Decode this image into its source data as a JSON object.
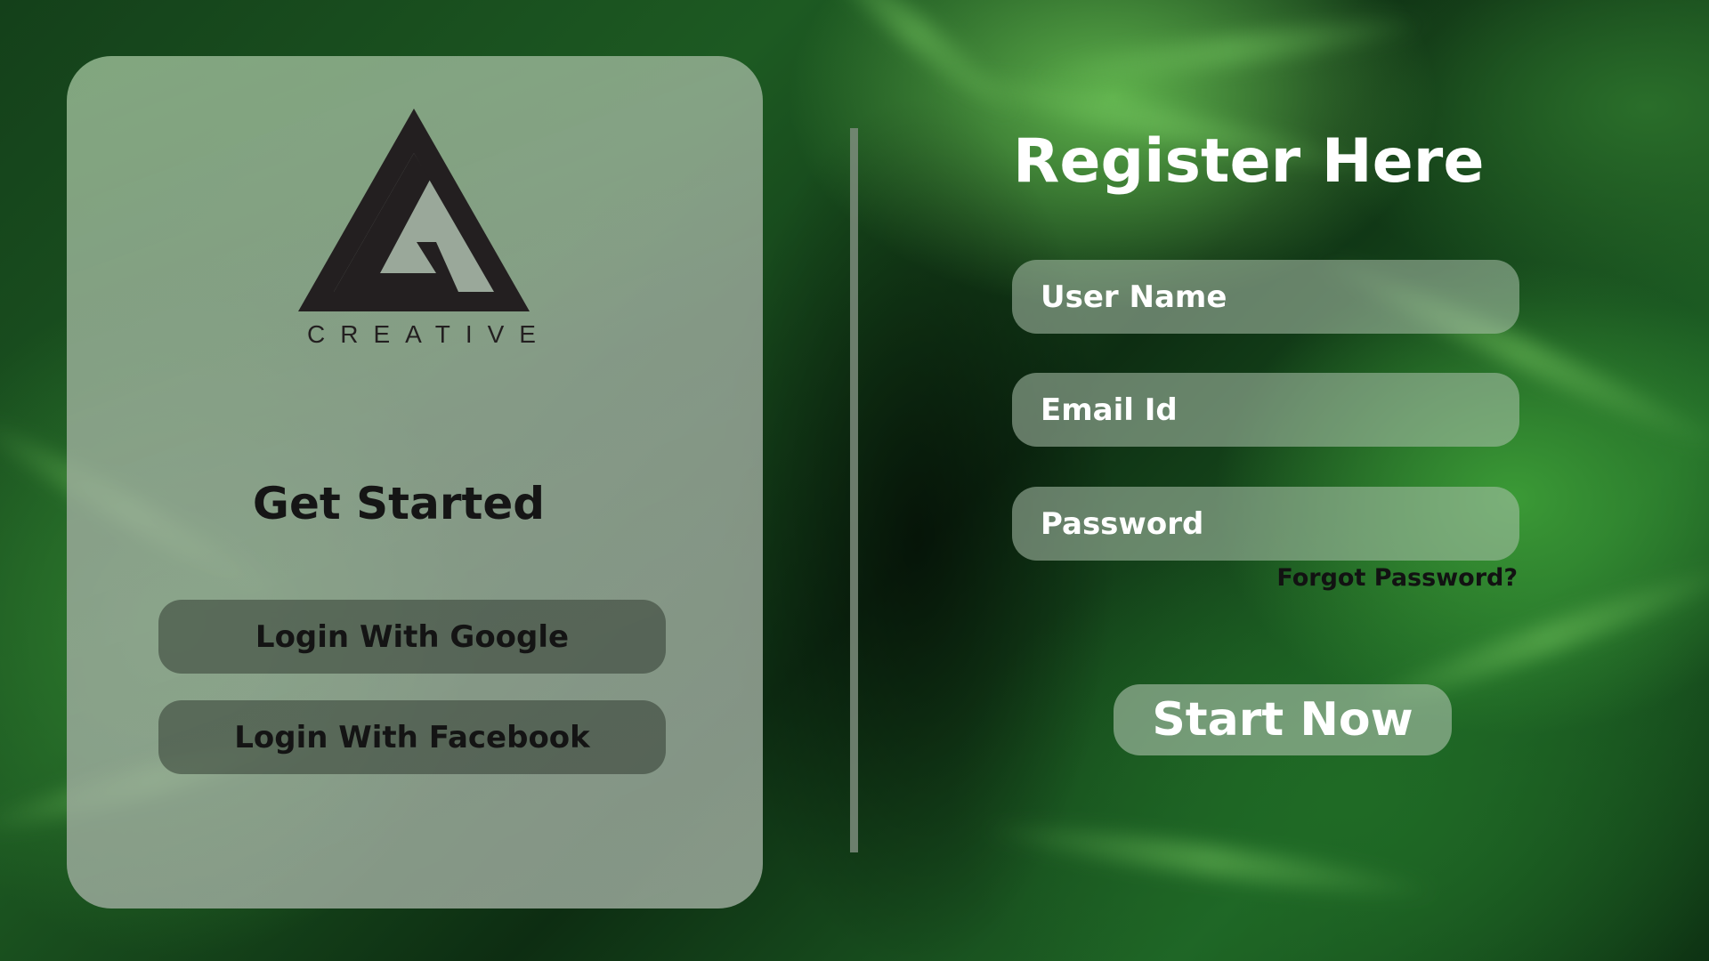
{
  "brand": {
    "name": "CREATIVE",
    "logo_icon": "triangle-logo-icon"
  },
  "left_panel": {
    "heading": "Get Started",
    "google_button": "Login With Google",
    "facebook_button": "Login With Facebook"
  },
  "register": {
    "title": "Register Here",
    "username_placeholder": "User Name",
    "email_placeholder": "Email Id",
    "password_placeholder": "Password",
    "forgot_password": "Forgot Password?",
    "submit_button": "Start Now"
  },
  "colors": {
    "background": "#1d5a22",
    "panel": "#aab4aa",
    "text_dark": "#151515",
    "text_light": "#ffffff"
  }
}
